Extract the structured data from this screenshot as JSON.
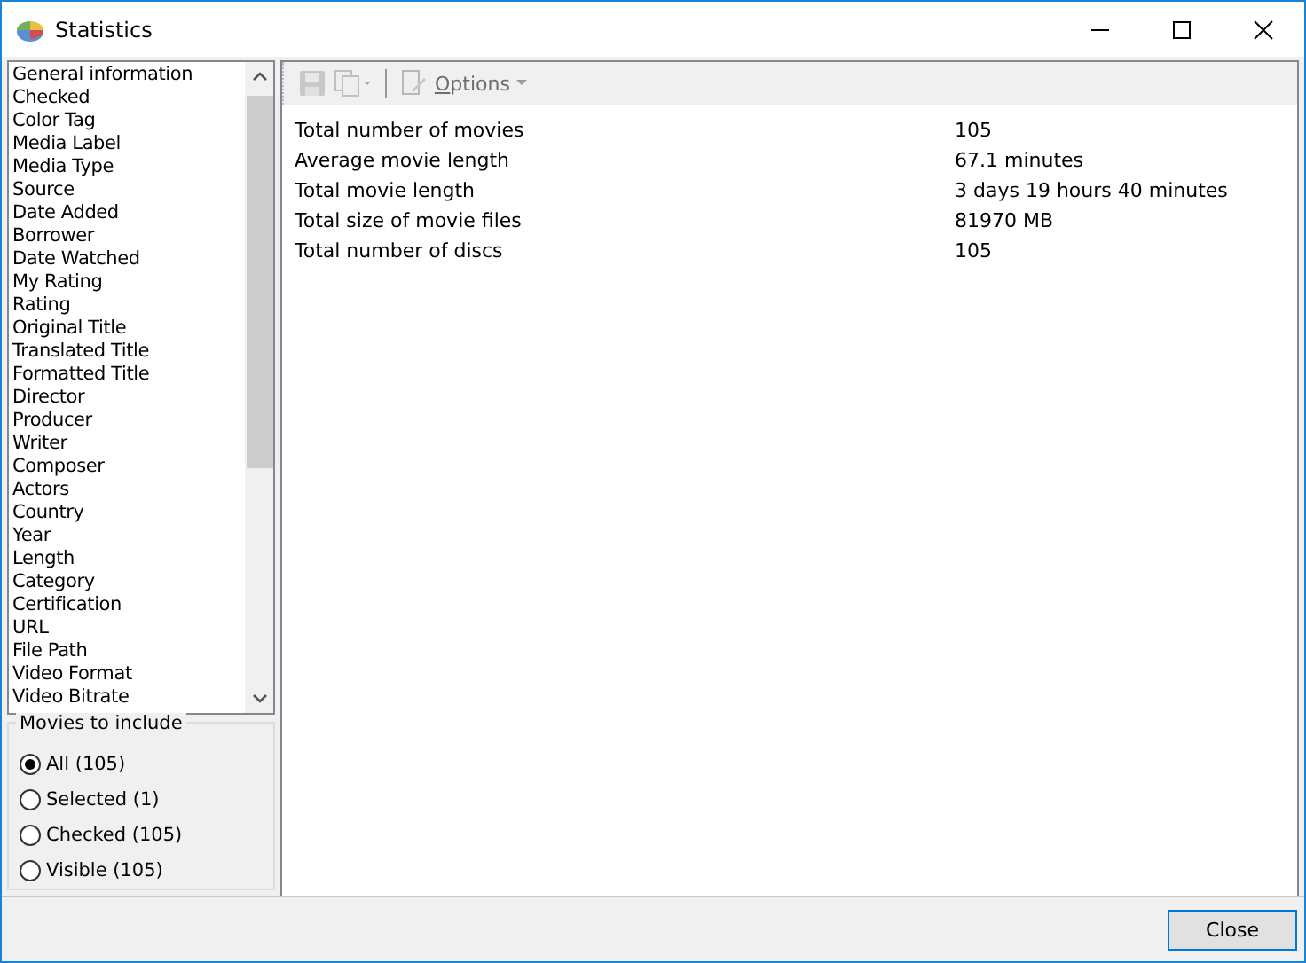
{
  "window": {
    "title": "Statistics"
  },
  "fields": [
    "General information",
    "Checked",
    "Color Tag",
    "Media Label",
    "Media Type",
    "Source",
    "Date Added",
    "Borrower",
    "Date Watched",
    "My Rating",
    "Rating",
    "Original Title",
    "Translated Title",
    "Formatted Title",
    "Director",
    "Producer",
    "Writer",
    "Composer",
    "Actors",
    "Country",
    "Year",
    "Length",
    "Category",
    "Certification",
    "URL",
    "File Path",
    "Video Format",
    "Video Bitrate"
  ],
  "include": {
    "title": "Movies to include",
    "options": [
      {
        "label": "All (105)",
        "selected": true
      },
      {
        "label": "Selected (1)",
        "selected": false
      },
      {
        "label": "Checked (105)",
        "selected": false
      },
      {
        "label": "Visible (105)",
        "selected": false
      }
    ]
  },
  "toolbar": {
    "options_label": "Options"
  },
  "stats": [
    {
      "name": "Total number of movies",
      "value": "105"
    },
    {
      "name": "Average movie length",
      "value": "67.1 minutes"
    },
    {
      "name": "Total movie length",
      "value": "3 days 19 hours 40 minutes"
    },
    {
      "name": "Total size of movie files",
      "value": "81970 MB"
    },
    {
      "name": "Total number of discs",
      "value": "105"
    }
  ],
  "buttons": [
    "Close"
  ]
}
